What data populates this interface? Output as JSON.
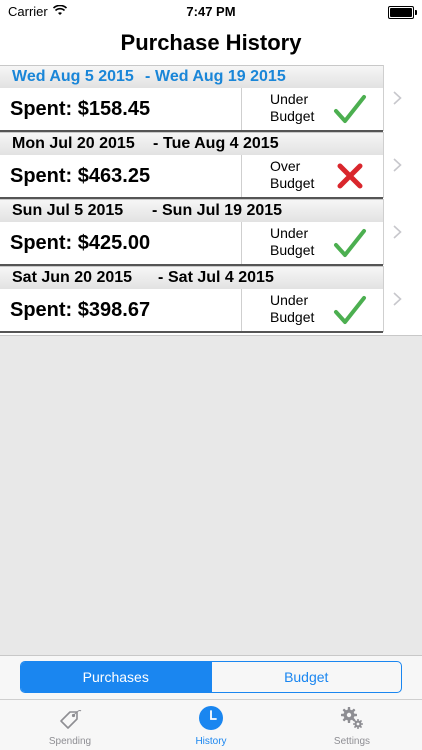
{
  "status_bar": {
    "carrier": "Carrier",
    "time": "7:47 PM"
  },
  "nav": {
    "title": "Purchase History"
  },
  "purchases": [
    {
      "start": "Wed Aug 5 2015",
      "separator": "-",
      "end": "Wed Aug 19 2015",
      "spent": "Spent: $158.45",
      "status_line1": "Under",
      "status_line2": "Budget",
      "status": "under",
      "active": true
    },
    {
      "start": "Mon Jul 20 2015",
      "separator": "-",
      "end": "Tue Aug 4 2015",
      "spent": "Spent: $463.25",
      "status_line1": "Over",
      "status_line2": "Budget",
      "status": "over",
      "active": false
    },
    {
      "start": "Sun Jul 5 2015",
      "separator": "-",
      "end": "Sun Jul 19 2015",
      "spent": "Spent: $425.00",
      "status_line1": "Under",
      "status_line2": "Budget",
      "status": "under",
      "active": false
    },
    {
      "start": "Sat Jun 20 2015",
      "separator": "-",
      "end": "Sat Jul 4 2015",
      "spent": "Spent: $398.67",
      "status_line1": "Under",
      "status_line2": "Budget",
      "status": "under",
      "active": false
    }
  ],
  "segmented": {
    "purchases": "Purchases",
    "budget": "Budget",
    "selected": "purchases"
  },
  "tabs": [
    {
      "label": "Spending",
      "icon": "price-tag-icon",
      "active": false
    },
    {
      "label": "History",
      "icon": "clock-icon",
      "active": true
    },
    {
      "label": "Settings",
      "icon": "gears-icon",
      "active": false
    }
  ],
  "colors": {
    "accent": "#1a86f0",
    "check": "#4caf50",
    "cross": "#d9262c",
    "active_date": "#1a86d8"
  }
}
